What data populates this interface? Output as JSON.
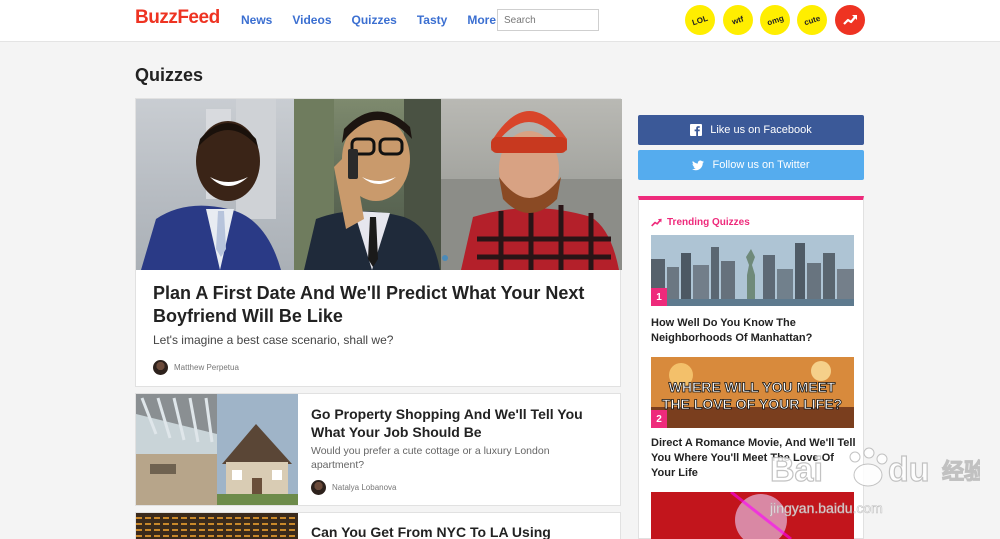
{
  "header": {
    "logo": "BuzzFeed",
    "nav": [
      "News",
      "Videos",
      "Quizzes",
      "Tasty"
    ],
    "more_label": "More",
    "search_placeholder": "Search",
    "badges": [
      "LOL",
      "wtf",
      "omg",
      "cute"
    ],
    "accent_color": "#ee3322"
  },
  "page": {
    "title": "Quizzes"
  },
  "feature": {
    "title": "Plan A First Date And We'll Predict What Your Next Boyfriend Will Be Like",
    "description": "Let's imagine a best case scenario, shall we?",
    "author": "Matthew Perpetua"
  },
  "cards": [
    {
      "title": "Go Property Shopping And We'll Tell You What Your Job Should Be",
      "description": "Would you prefer a cute cottage or a luxury London apartment?",
      "author": "Natalya Lobanova"
    },
    {
      "title": "Can You Get From NYC To LA Using"
    }
  ],
  "sidebar": {
    "facebook_label": "Like us on Facebook",
    "twitter_label": "Follow us on Twitter",
    "trending_label": "Trending Quizzes",
    "trending": [
      {
        "rank": "1",
        "title": "How Well Do You Know The Neighborhoods Of Manhattan?"
      },
      {
        "rank": "2",
        "title": "Direct A Romance Movie, And We'll Tell You Where You'll Meet The Love Of Your Life",
        "image_text": "WHERE WILL YOU MEET THE LOVE OF YOUR LIFE?"
      }
    ]
  },
  "watermark": {
    "brand": "Baidu",
    "cn": "经验",
    "url": "jingyan.baidu.com"
  }
}
